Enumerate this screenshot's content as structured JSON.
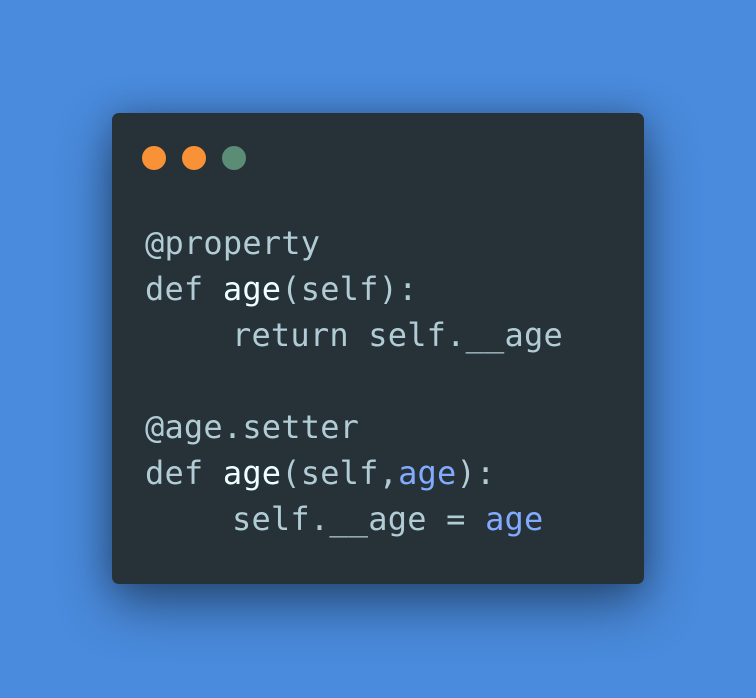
{
  "colors": {
    "background": "#4a8bdd",
    "window": "#263238",
    "dot_close": "#f99236",
    "dot_minimize": "#f99236",
    "dot_maximize": "#5b8c76",
    "text": "#b2ccd6",
    "function_name": "#eeffff",
    "parameter": "#82aaff"
  },
  "window_controls": {
    "close_icon": "circle-icon",
    "minimize_icon": "circle-icon",
    "maximize_icon": "circle-icon"
  },
  "code": {
    "line1": {
      "decorator": "@property"
    },
    "line2": {
      "keyword": "def",
      "name": "age",
      "open": "(",
      "arg": "self",
      "close": "):"
    },
    "line3": {
      "keyword": "return",
      "expr": "self.__age"
    },
    "line5": {
      "decorator": "@age.setter"
    },
    "line6": {
      "keyword": "def",
      "name": "age",
      "open": "(",
      "arg1": "self",
      "comma": ",",
      "arg2": "age",
      "close": "):"
    },
    "line7": {
      "target": "self.__age",
      "op": "=",
      "value": "age"
    }
  }
}
